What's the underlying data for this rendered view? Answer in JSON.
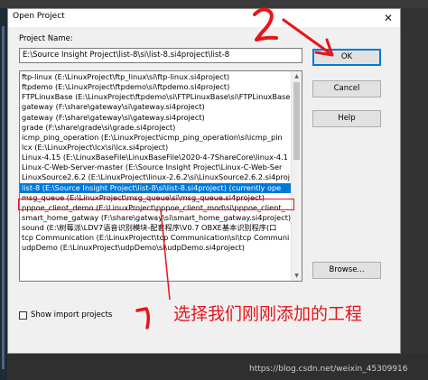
{
  "dialog": {
    "title": "Open Project",
    "close_glyph": "✕"
  },
  "project_name": {
    "label": "Project Name:",
    "value": "E:\\Source Insight Project\\list-8\\si\\list-8.si4project\\list-8"
  },
  "projects": [
    "ftp-linux (E:\\LinuxProject\\ftp_linux\\si\\ftp-linux.si4project)",
    "ftpdemo (E:\\LinuxProject\\ftpdemo\\si\\ftpdemo.si4project)",
    "FTPLinuxBase (E:\\LinuxProject\\ftpdemo\\si\\FTPLinuxBase\\si\\FTPLinuxBase.si",
    "gateway (F:\\share\\gateway\\si\\gateway.si4project)",
    "gateway (F:\\share\\gateway\\si\\gateway.si4project)",
    "grade (F:\\share\\grade\\si\\grade.si4project)",
    "icmp_ping_operation (E:\\LinuxProject\\icmp_ping_operation\\si\\icmp_pin",
    "lcx (E:\\LinuxProject\\lcx\\si\\lcx.si4project)",
    "Linux-4.15 (E:\\LinuxBaseFile\\LinuxBaseFile\\2020-4-7ShareCore\\linux-4.1",
    "Linux-C-Web-Server-master (E:\\Source Insight Project\\Linux-C-Web-Ser",
    "LinuxSource2.6.2 (E:\\LinuxProject\\linux-2.6.2\\si\\LinuxSource2.6.2.si4proj",
    "list-8 (E:\\Source Insight Project\\list-8\\si\\list-8.si4project)   (currently ope",
    "msg_queue (E:\\LinuxProject\\msg_queue\\si\\msg_queue.si4project)",
    "pppoe_client_demo (E:\\LinuxProject\\pppoe_client_mod\\si\\pppoe_client_",
    "smart_home_gatway (F:\\share\\gatway\\si\\smart_home_gatway.si4project)",
    "sound (E:\\树莓派\\LDV7语音识别模块-配套程序\\V0.7 OBXE基本识别程序(口",
    "tcp Communication (E:\\LinuxProject\\tcp Communication\\si\\tcp Communi",
    "udpDemo (E:\\LinuxProject\\udpDemo\\si\\udpDemo.si4project)"
  ],
  "selected_index": 11,
  "buttons": {
    "ok": "OK",
    "cancel": "Cancel",
    "help": "Help",
    "browse": "Browse..."
  },
  "show_import": {
    "label": "Show import projects",
    "checked": false
  },
  "annotations": {
    "caption": "选择我们刚刚添加的工程",
    "color": "#e8141a"
  },
  "watermark": "https://blog.csdn.net/weixin_45309916",
  "colors": {
    "selection": "#0078d7",
    "default_button_border": "#0078d7"
  }
}
